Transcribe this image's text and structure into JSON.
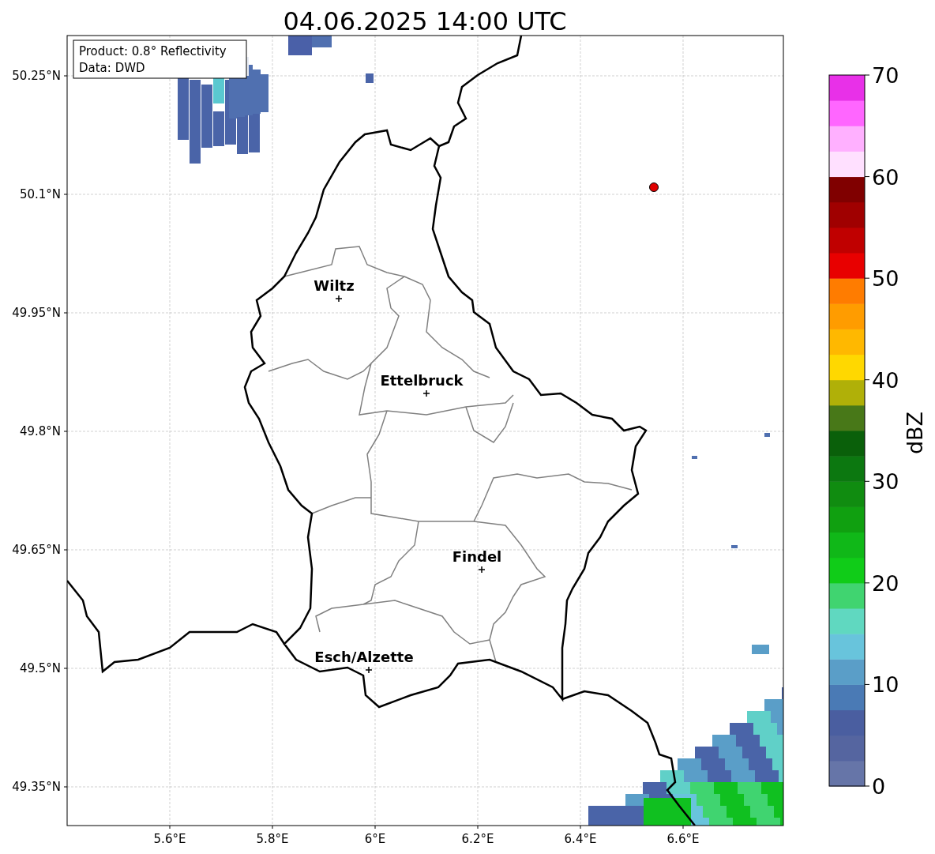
{
  "title": "04.06.2025 14:00 UTC",
  "info_box": [
    "Product: 0.8° Reflectivity",
    "Data: DWD"
  ],
  "yticks": [
    "50.25°N",
    "50.1°N",
    "49.95°N",
    "49.8°N",
    "49.65°N",
    "49.5°N",
    "49.35°N"
  ],
  "xticks": [
    "5.6°E",
    "5.8°E",
    "6°E",
    "6.2°E",
    "6.4°E",
    "6.6°E"
  ],
  "cities": [
    {
      "name": "Wiltz"
    },
    {
      "name": "Ettelbruck"
    },
    {
      "name": "Findel"
    },
    {
      "name": "Esch/Alzette"
    }
  ],
  "colorbar": {
    "label": "dBZ",
    "ticks": [
      "70",
      "60",
      "50",
      "40",
      "30",
      "20",
      "10",
      "0"
    ]
  }
}
